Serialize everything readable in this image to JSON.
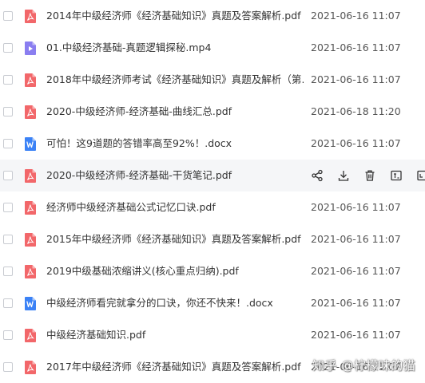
{
  "files": [
    {
      "name": "2014年中级经济师《经济基础知识》真题及答案解析.pdf",
      "type": "pdf-icon",
      "date": "2021-06-16 11:07"
    },
    {
      "name": "01.中级经济基础-真题逻辑探秘.mp4",
      "type": "video-icon",
      "date": "2021-06-16 11:07"
    },
    {
      "name": "2018年中级经济师考试《经济基础知识》真题及解析（第…",
      "type": "pdf-icon",
      "date": "2021-06-16 11:07"
    },
    {
      "name": "2020-中级经济师-经济基础-曲线汇总.pdf",
      "type": "pdf-icon",
      "date": "2021-06-18 11:20"
    },
    {
      "name": "可怕！这9道题的答错率高至92%！.docx",
      "type": "word-icon",
      "date": "2021-06-16 11:07"
    },
    {
      "name": "2020-中级经济师-经济基础-干货笔记.pdf",
      "type": "pdf-icon",
      "date": ""
    },
    {
      "name": "经济师中级经济基础公式记忆口诀.pdf",
      "type": "pdf-icon",
      "date": "2021-06-16 11:07"
    },
    {
      "name": "2015年中级经济师《经济基础知识》真题及答案解析.pdf",
      "type": "pdf-icon",
      "date": "2021-06-16 11:07"
    },
    {
      "name": "2019中级基础浓缩讲义(核心重点归纳).pdf",
      "type": "pdf-icon",
      "date": "2021-06-16 11:07"
    },
    {
      "name": "中级经济师看完就拿分的口诀，你还不快来！.docx",
      "type": "word-icon",
      "date": "2021-06-16 11:07"
    },
    {
      "name": "中级经济基础知识.pdf",
      "type": "pdf-icon",
      "date": "2021-06-16 11:07"
    },
    {
      "name": "2017年中级经济师《经济基础知识》真题及答案解析.pdf",
      "type": "pdf-icon",
      "date": "2021-06-16 11:07"
    }
  ],
  "hover_actions": [
    "share-icon",
    "download-icon",
    "delete-icon",
    "copy-icon",
    "more-icon"
  ],
  "watermark": "知乎 @柠檬味的猫",
  "colors": {
    "pdf": "#f2676a",
    "video": "#8a7ef0",
    "word": "#3b82f6",
    "hover_row": "#f5f6f8"
  }
}
